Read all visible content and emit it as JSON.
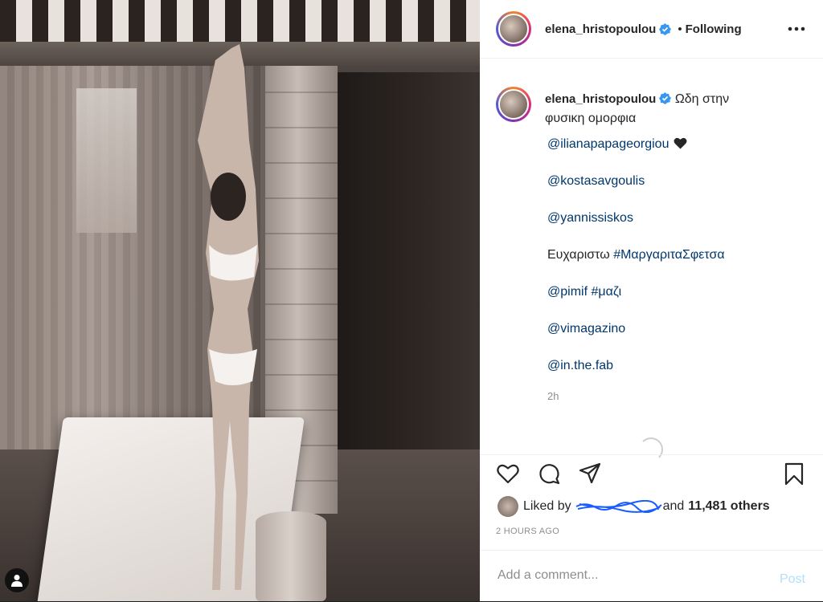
{
  "post": {
    "username": "elena_hristopoulou",
    "follow_dot": "•",
    "follow_label": "Following",
    "caption_text": "Ωδη στην φυσικη ομορφια",
    "caption_lines": [
      {
        "text": "@ilianapapageorgiou",
        "type": "mention",
        "suffix_icon": "heart-icon"
      },
      {
        "text": "@kostasavgoulis",
        "type": "mention"
      },
      {
        "text": "@yannissiskos",
        "type": "mention"
      },
      {
        "prefix": "Ευχαριστω ",
        "text": "#ΜαργαριταΣφετσα",
        "type": "hashtag"
      },
      {
        "text": "@pimif",
        "extra": "#μαζι",
        "type": "mention"
      },
      {
        "text": "@vimagazino",
        "type": "mention"
      },
      {
        "text": "@in.the.fab",
        "type": "mention"
      }
    ],
    "caption_age": "2h",
    "likes_prefix": "Liked by",
    "likes_suffix": "and",
    "likes_count_label": "11,481 others",
    "time_ago": "2 HOURS AGO",
    "comment_placeholder": "Add a comment...",
    "post_label": "Post"
  },
  "icons": {
    "verified": "verified-badge-icon",
    "more": "more-options-icon",
    "like": "heart-outline-icon",
    "comment": "comment-icon",
    "share": "send-icon",
    "save": "bookmark-icon",
    "user_tag": "user-tag-icon"
  },
  "colors": {
    "link": "#00376b",
    "verified": "#3897f0",
    "post_disabled": "#b2dffc",
    "scribble": "#1a5cff"
  }
}
